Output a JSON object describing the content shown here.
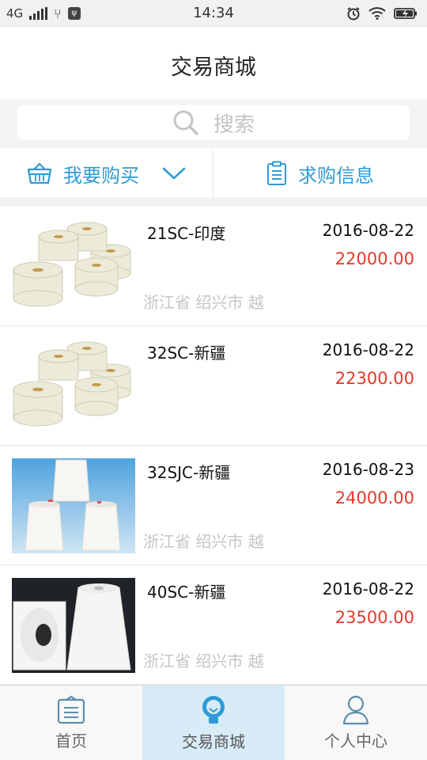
{
  "status_bar": {
    "network": "4G",
    "time": "14:34"
  },
  "header": {
    "title": "交易商城"
  },
  "search": {
    "placeholder": "搜索"
  },
  "tabs": {
    "buy_label": "我要购买",
    "request_label": "求购信息"
  },
  "listings": [
    {
      "name": "21SC-印度",
      "date": "2016-08-22",
      "price": "22000.00",
      "location": "浙江省 绍兴市 越",
      "image": "yarn-spools"
    },
    {
      "name": "32SC-新疆",
      "date": "2016-08-22",
      "price": "22300.00",
      "location": "",
      "image": "yarn-spools"
    },
    {
      "name": "32SJC-新疆",
      "date": "2016-08-23",
      "price": "24000.00",
      "location": "浙江省 绍兴市 越",
      "image": "yarn-cones-blue"
    },
    {
      "name": "40SC-新疆",
      "date": "2016-08-22",
      "price": "23500.00",
      "location": "浙江省 绍兴市 越",
      "image": "yarn-cones-dark"
    }
  ],
  "bottom_nav": {
    "home_label": "首页",
    "mall_label": "交易商城",
    "profile_label": "个人中心",
    "active": "mall"
  },
  "colors": {
    "accent": "#2e9bd6",
    "price": "#e03a2c",
    "active_tab_bg": "#d7ecf7"
  }
}
